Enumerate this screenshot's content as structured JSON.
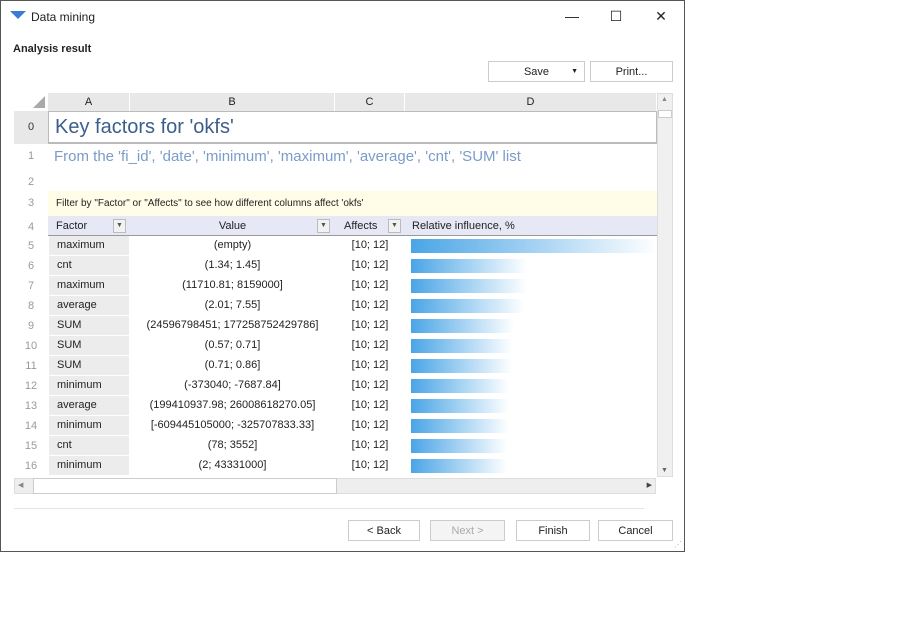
{
  "window": {
    "title": "Data mining",
    "icon": "app-funnel-icon",
    "minimize": "—",
    "maximize": "☐",
    "close": "✕"
  },
  "header": {
    "section": "Analysis result"
  },
  "toolbar": {
    "save_label": "Save",
    "print_label": "Print..."
  },
  "grid": {
    "columns": [
      "A",
      "B",
      "C",
      "D"
    ],
    "row_numbers": [
      "0",
      "1",
      "2",
      "3",
      "4",
      "5",
      "6",
      "7",
      "8",
      "9",
      "10",
      "11",
      "12",
      "13",
      "14",
      "15",
      "16"
    ],
    "title": "Key factors for 'okfs'",
    "subtitle": "From the 'fi_id', 'date', 'minimum', 'maximum', 'average', 'cnt', 'SUM' list",
    "hint": "Filter by \"Factor\" or \"Affects\" to see how different columns affect 'okfs'",
    "headers": {
      "factor": "Factor",
      "value": "Value",
      "affects": "Affects",
      "influence": "Relative influence, %"
    },
    "rows": [
      {
        "factor": "maximum",
        "value": "(empty)",
        "affects": "[10; 12]",
        "influence": 100
      },
      {
        "factor": "cnt",
        "value": "(1.34; 1.45]",
        "affects": "[10; 12]",
        "influence": 47
      },
      {
        "factor": "maximum",
        "value": "(11710.81; 8159000]",
        "affects": "[10; 12]",
        "influence": 47
      },
      {
        "factor": "average",
        "value": "(2.01; 7.55]",
        "affects": "[10; 12]",
        "influence": 46
      },
      {
        "factor": "SUM",
        "value": "(24596798451; 177258752429786]",
        "affects": "[10; 12]",
        "influence": 42
      },
      {
        "factor": "SUM",
        "value": "(0.57; 0.71]",
        "affects": "[10; 12]",
        "influence": 41
      },
      {
        "factor": "SUM",
        "value": "(0.71; 0.86]",
        "affects": "[10; 12]",
        "influence": 41
      },
      {
        "factor": "minimum",
        "value": "(-373040; -7687.84]",
        "affects": "[10; 12]",
        "influence": 40
      },
      {
        "factor": "average",
        "value": "(199410937.98; 26008618270.05]",
        "affects": "[10; 12]",
        "influence": 40
      },
      {
        "factor": "minimum",
        "value": "[-609445105000; -325707833.33]",
        "affects": "[10; 12]",
        "influence": 40
      },
      {
        "factor": "cnt",
        "value": "(78; 3552]",
        "affects": "[10; 12]",
        "influence": 39
      },
      {
        "factor": "minimum",
        "value": "(2; 43331000]",
        "affects": "[10; 12]",
        "influence": 39
      }
    ]
  },
  "footer": {
    "back": "< Back",
    "next": "Next >",
    "finish": "Finish",
    "cancel": "Cancel"
  }
}
